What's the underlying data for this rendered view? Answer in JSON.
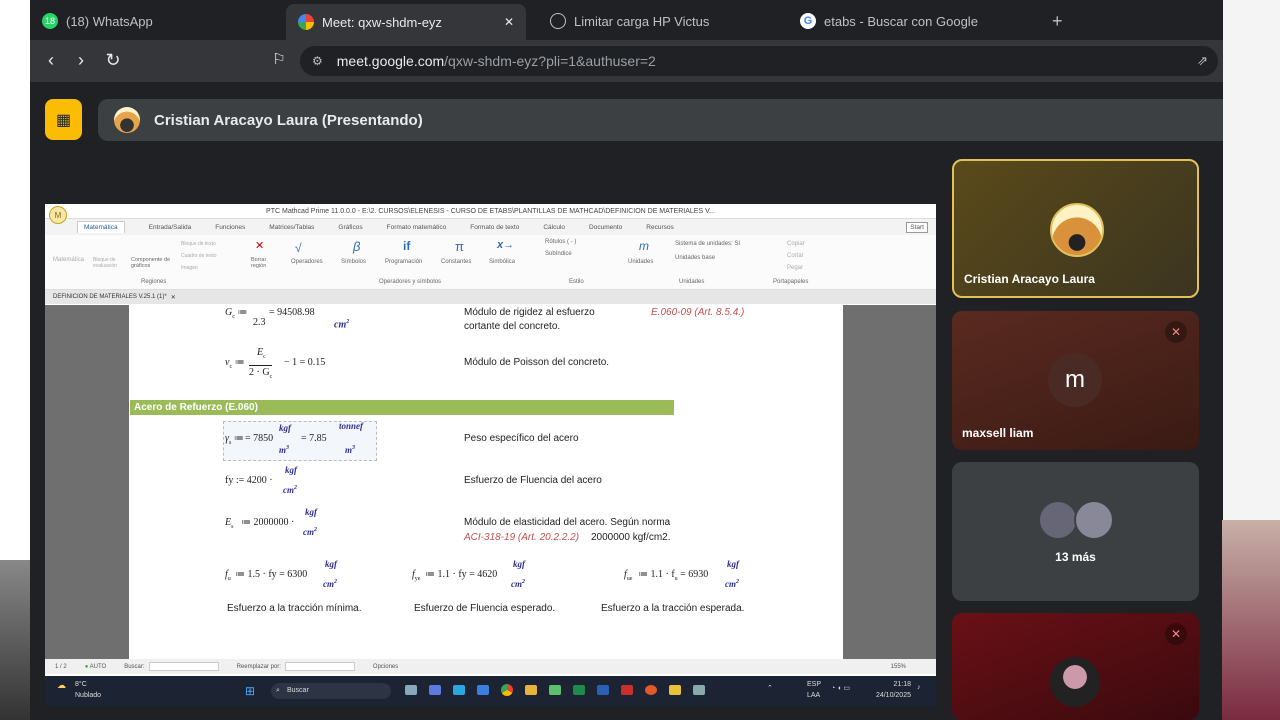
{
  "browser": {
    "tabs": [
      {
        "label": "(18) WhatsApp",
        "badge": "18",
        "icon": "whatsapp-icon"
      },
      {
        "label": "Meet: qxw-shdm-eyz",
        "icon": "meet-icon",
        "active": true
      },
      {
        "label": "Limitar carga HP Victus",
        "icon": "openai-icon"
      },
      {
        "label": "etabs - Buscar con Google",
        "icon": "google-icon"
      }
    ],
    "url_host": "meet.google.com",
    "url_path": "/qxw-shdm-eyz?pli=1&authuser=2",
    "new_tab": "+",
    "close_tab": "✕"
  },
  "meet": {
    "presenter_bar": "Cristian Aracayo Laura (Presentando)",
    "tiles": [
      {
        "name": "Cristian Aracayo Laura",
        "highlighted": true,
        "muted": false
      },
      {
        "name": "maxsell liam",
        "initial": "m",
        "muted": true
      },
      {
        "name": "13 más",
        "muted": false
      },
      {
        "name": "",
        "muted": true
      }
    ]
  },
  "mathcad": {
    "window_title": "PTC Mathcad Prime 11.0.0.0 - E:\\2. CURSOS\\ELENESIS - CURSO DE ETABS\\PLANTILLAS DE MATHCAD\\DEFINICION DE MATERIALES V...",
    "tabs": [
      "Matemática",
      "Entrada/Salida",
      "Funciones",
      "Matrices/Tablas",
      "Gráficos",
      "Formato matemático",
      "Formato de texto",
      "Cálculo",
      "Documento",
      "Recursos"
    ],
    "ribbon_groups": [
      "Regiones",
      "Operadores y símbolos",
      "Estilo",
      "Unidades",
      "Portapapeles"
    ],
    "ribbon_items": {
      "matematica": "Matemática",
      "bloque_evaluacion": "Bloque de evaluación",
      "componente_graficos": "Componente de gráficos",
      "bloque_texto": "Bloque de texto",
      "cuadro_texto": "Cuadro de texto",
      "imagen": "Imagen",
      "borrar_region": "Borrar región",
      "operadores": "Operadores",
      "simbolos": "Símbolos",
      "programacion": "Programación",
      "constantes": "Constantes",
      "simbolica": "Simbólica",
      "rotulos": "Rótulos",
      "rotulos_value": "( - )",
      "subindice": "Subíndice",
      "unidades": "Unidades",
      "sistema_unidades": "Sistema de unidades:",
      "sistema_value": "SI",
      "unidades_base": "Unidades base",
      "copiar": "Copiar",
      "cortar": "Cortar",
      "pegar": "Pegar",
      "start": "Start"
    },
    "doc_tab": "DEFINICION DE MATERIALES V.25.1 (1)*",
    "rows": {
      "gc_expr": "G",
      "gc_den": "2.3",
      "gc_value": "= 94508.98",
      "gc_desc1": "Módulo de rigidez al esfuerzo",
      "gc_desc2": "cortante del concreto.",
      "gc_ref": "E.060-09 (Art. 8.5.4.)",
      "vc_num": "E",
      "vc_den": "2 · G",
      "vc_value": "− 1 = 0.15",
      "vc_desc": "Módulo de Poisson del concreto.",
      "section": "Acero de Refuerzo (E.060)",
      "gs_value": "= 7850",
      "gs_value2": "= 7.85",
      "gs_desc": "Peso específico del acero",
      "fy_value": "fy := 4200 ·",
      "fy_desc": "Esfuerzo de Fluencia del acero",
      "es_value": "≔ 2000000 ·",
      "es_desc1": "Módulo de elasticidad del acero. Según norma",
      "es_ref": "ACI-318-19 (Art. 20.2.2.2)",
      "es_desc2": "2000000 kgf/cm2.",
      "fu_expr": "≔ 1.5 · fy = 6300",
      "fye_expr": "≔ 1.1 · fy = 4620",
      "fue_expr": "≔ 1.1 · f",
      "fue_value": "= 6930",
      "fu_desc": "Esfuerzo a la tracción mínima.",
      "fye_desc": "Esfuerzo de Fluencia esperado.",
      "fue_desc": "Esfuerzo a la tracción esperada."
    },
    "units": {
      "kgf": "kgf",
      "cm2": "cm",
      "m3": "m",
      "tonnef": "tonnef"
    },
    "status": {
      "page": "1 / 2",
      "auto": "AUTO",
      "buscar": "Buscar:",
      "reemplazar": "Reemplazar por:",
      "opciones": "Opciones",
      "zoom": "155%"
    }
  },
  "taskbar": {
    "weather_temp": "8°C",
    "weather_desc": "Nublado",
    "search": "Buscar",
    "lang1": "ESP",
    "lang2": "LAA",
    "time": "21:18",
    "date": "24/10/2025"
  }
}
